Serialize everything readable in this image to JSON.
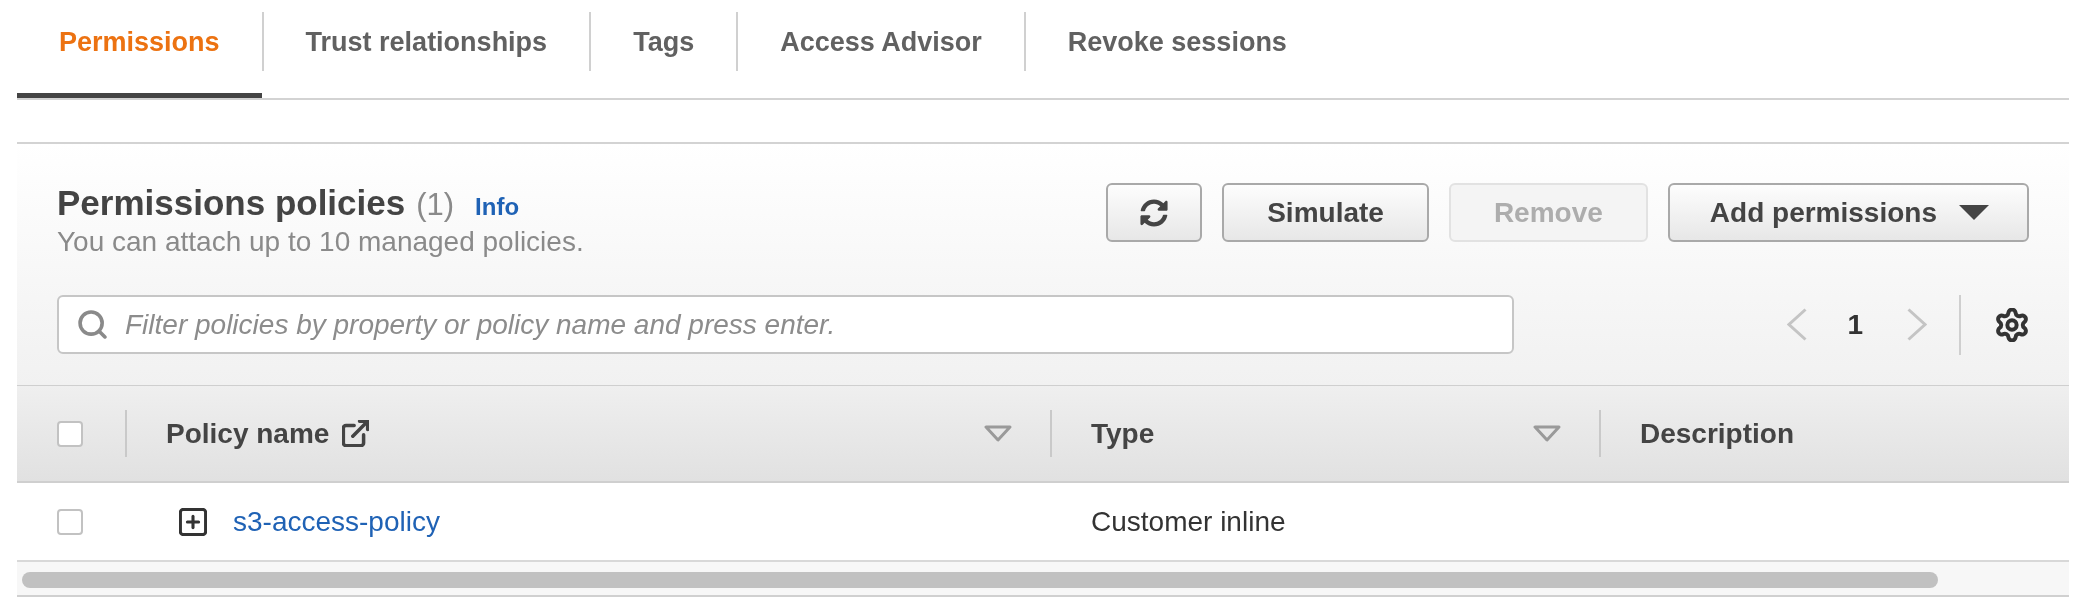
{
  "tabs": [
    {
      "label": "Permissions",
      "selected": true
    },
    {
      "label": "Trust relationships",
      "selected": false
    },
    {
      "label": "Tags",
      "selected": false
    },
    {
      "label": "Access Advisor",
      "selected": false
    },
    {
      "label": "Revoke sessions",
      "selected": false
    }
  ],
  "panel": {
    "title": "Permissions policies",
    "count": "(1)",
    "info_link": "Info",
    "description": "You can attach up to 10 managed policies.",
    "actions": [
      {
        "kind": "refresh",
        "disabled": false
      },
      {
        "kind": "button",
        "label": "Simulate",
        "disabled": false
      },
      {
        "kind": "button",
        "label": "Remove",
        "disabled": true
      },
      {
        "kind": "dropdown",
        "label": "Add permissions",
        "disabled": false
      }
    ],
    "search": {
      "placeholder": "Filter policies by property or policy name and press enter."
    },
    "pagination": {
      "previous": {
        "disabled": true
      },
      "pages": [
        {
          "label": "1",
          "selected": true
        }
      ],
      "next": {
        "disabled": true
      }
    }
  },
  "table": {
    "select_all": {
      "checked": false
    },
    "columns": [
      {
        "label": "Policy name",
        "external_link": true,
        "sortable": true
      },
      {
        "label": "Type",
        "external_link": false,
        "sortable": true
      },
      {
        "label": "Description",
        "external_link": false,
        "sortable": false
      }
    ],
    "rows": [
      {
        "checked": false,
        "expanded": false,
        "policy_name": "s3-access-policy",
        "type": "Customer inline"
      }
    ]
  }
}
